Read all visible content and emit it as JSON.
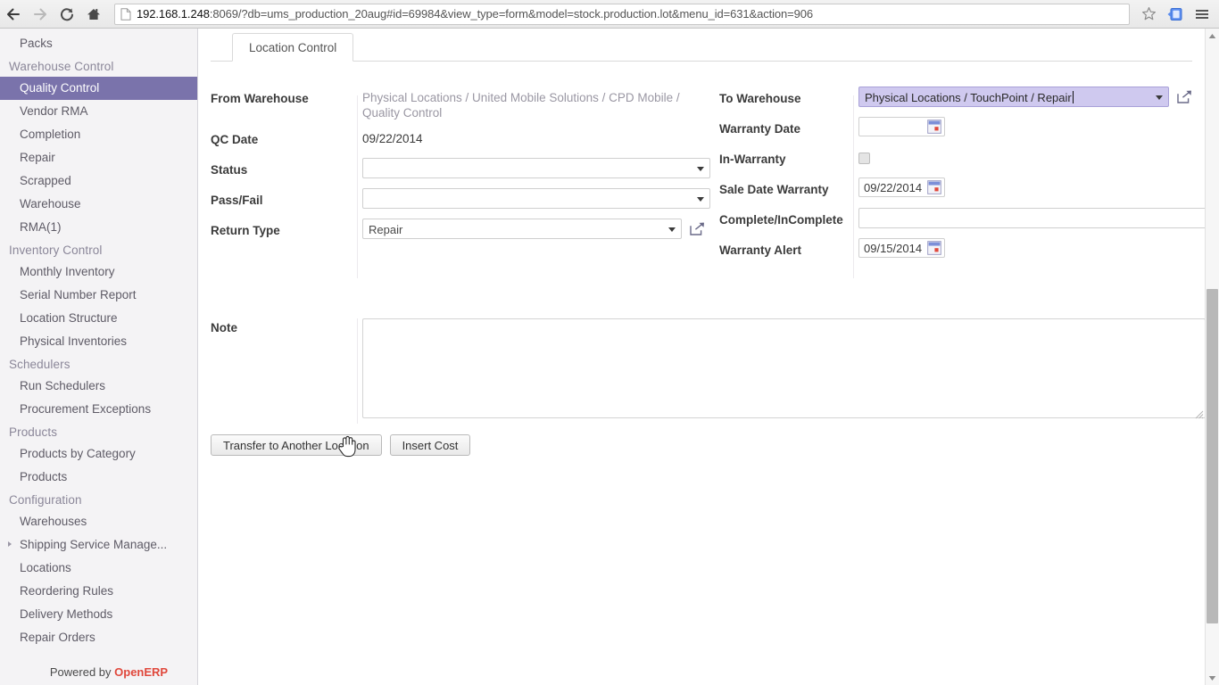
{
  "browser": {
    "back_icon": "back-arrow-icon",
    "forward_icon": "forward-arrow-icon",
    "reload_icon": "reload-icon",
    "home_icon": "home-icon",
    "page_icon": "page-document-icon",
    "url_host": "192.168.1.248",
    "url_rest": ":8069/?db=ums_production_20aug#id=69984&view_type=form&model=stock.production.lot&menu_id=631&action=906",
    "url_full": "192.168.1.248:8069/?db=ums_production_20aug#id=69984&view_type=form&model=stock.production.lot&menu_id=631&action=906",
    "bookmark_icon": "star-bookmark-icon",
    "extension_icon": "extension-icon",
    "menu_icon": "hamburger-menu-icon"
  },
  "sidebar": {
    "top_item": {
      "label": "Packs"
    },
    "sections": [
      {
        "title": "Warehouse Control",
        "items": [
          {
            "label": "Quality Control",
            "active": true
          },
          {
            "label": "Vendor RMA",
            "active": false
          },
          {
            "label": "Completion",
            "active": false
          },
          {
            "label": "Repair",
            "active": false
          },
          {
            "label": "Scrapped",
            "active": false
          },
          {
            "label": "Warehouse",
            "active": false
          },
          {
            "label": "RMA(1)",
            "active": false
          }
        ]
      },
      {
        "title": "Inventory Control",
        "items": [
          {
            "label": "Monthly Inventory",
            "active": false
          },
          {
            "label": "Serial Number Report",
            "active": false
          },
          {
            "label": "Location Structure",
            "active": false
          },
          {
            "label": "Physical Inventories",
            "active": false
          }
        ]
      },
      {
        "title": "Schedulers",
        "items": [
          {
            "label": "Run Schedulers",
            "active": false
          },
          {
            "label": "Procurement Exceptions",
            "active": false
          }
        ]
      },
      {
        "title": "Products",
        "items": [
          {
            "label": "Products by Category",
            "active": false
          },
          {
            "label": "Products",
            "active": false
          }
        ]
      },
      {
        "title": "Configuration",
        "items": [
          {
            "label": "Warehouses",
            "active": false,
            "expandable": false
          },
          {
            "label": "Shipping Service Manage...",
            "active": false,
            "expandable": true
          },
          {
            "label": "Locations",
            "active": false,
            "expandable": false
          },
          {
            "label": "Reordering Rules",
            "active": false,
            "expandable": false
          },
          {
            "label": "Delivery Methods",
            "active": false,
            "expandable": false
          },
          {
            "label": "Repair Orders",
            "active": false,
            "expandable": false
          }
        ]
      }
    ],
    "footer_prefix": "Powered by ",
    "footer_brand": "OpenERP"
  },
  "tabs": [
    {
      "label": "Location Control",
      "active": true
    }
  ],
  "form": {
    "left": {
      "from_warehouse": {
        "label": "From Warehouse",
        "value": "Physical Locations / United Mobile Solutions / CPD Mobile / Quality Control"
      },
      "qc_date": {
        "label": "QC Date",
        "value": "09/22/2014"
      },
      "status": {
        "label": "Status",
        "value": "",
        "placeholder": ""
      },
      "pass_fail": {
        "label": "Pass/Fail",
        "value": "",
        "placeholder": ""
      },
      "return_type": {
        "label": "Return Type",
        "value": "Repair",
        "link_icon": "external-link-icon"
      }
    },
    "right": {
      "to_warehouse": {
        "label": "To Warehouse",
        "value": "Physical Locations / TouchPoint / Repair",
        "focused": true,
        "link_icon": "external-link-icon"
      },
      "warranty_date": {
        "label": "Warranty Date",
        "value": "",
        "calendar_icon": "calendar-icon"
      },
      "in_warranty": {
        "label": "In-Warranty",
        "checked": false
      },
      "sale_date_warranty": {
        "label": "Sale Date Warranty",
        "value": "09/22/2014",
        "calendar_icon": "calendar-icon"
      },
      "complete_incomplete": {
        "label": "Complete/InComplete",
        "value": ""
      },
      "warranty_alert": {
        "label": "Warranty Alert",
        "value": "09/15/2014",
        "calendar_icon": "calendar-icon"
      }
    },
    "note": {
      "label": "Note",
      "value": "",
      "placeholder": ""
    },
    "buttons": [
      {
        "label": "Transfer to Another Location",
        "hovered": true
      },
      {
        "label": "Insert Cost",
        "hovered": false
      }
    ]
  },
  "colors": {
    "sidebar_bg": "#f4f3f5",
    "active_item_bg": "#7a73ab",
    "section_heading": "#8b8799",
    "focus_field_bg": "#cfc9ef",
    "brand_red": "#e0483c"
  }
}
